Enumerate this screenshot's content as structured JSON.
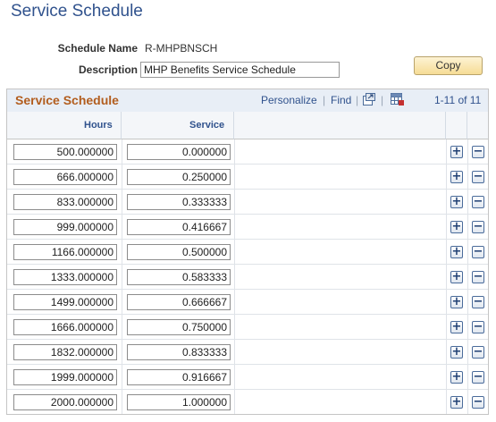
{
  "page": {
    "title": "Service Schedule"
  },
  "form": {
    "schedule_name_label": "Schedule Name",
    "schedule_name_value": "R-MHPBNSCH",
    "description_label": "Description",
    "description_value": "MHP Benefits Service Schedule",
    "copy_button_label": "Copy"
  },
  "grid": {
    "title": "Service Schedule",
    "personalize_link": "Personalize",
    "find_link": "Find",
    "separator": "|",
    "pager_text": "1-11 of 11",
    "columns": [
      "Hours",
      "Service"
    ],
    "rows": [
      {
        "hours": "500.000000",
        "service": "0.000000"
      },
      {
        "hours": "666.000000",
        "service": "0.250000"
      },
      {
        "hours": "833.000000",
        "service": "0.333333"
      },
      {
        "hours": "999.000000",
        "service": "0.416667"
      },
      {
        "hours": "1166.000000",
        "service": "0.500000"
      },
      {
        "hours": "1333.000000",
        "service": "0.583333"
      },
      {
        "hours": "1499.000000",
        "service": "0.666667"
      },
      {
        "hours": "1666.000000",
        "service": "0.750000"
      },
      {
        "hours": "1832.000000",
        "service": "0.833333"
      },
      {
        "hours": "1999.000000",
        "service": "0.916667"
      },
      {
        "hours": "2000.000000",
        "service": "1.000000"
      }
    ],
    "add_row_symbol": "+",
    "delete_row_symbol": "−"
  },
  "icons": {
    "view_all": "new-window-icon",
    "download": "spreadsheet-download-icon",
    "add_row": "plus-icon",
    "delete_row": "minus-icon"
  },
  "colors": {
    "title_blue": "#30528d",
    "grid_title_orange": "#b25d1e",
    "header_bg": "#e8eef6",
    "button_gold": "#f6dc95"
  }
}
